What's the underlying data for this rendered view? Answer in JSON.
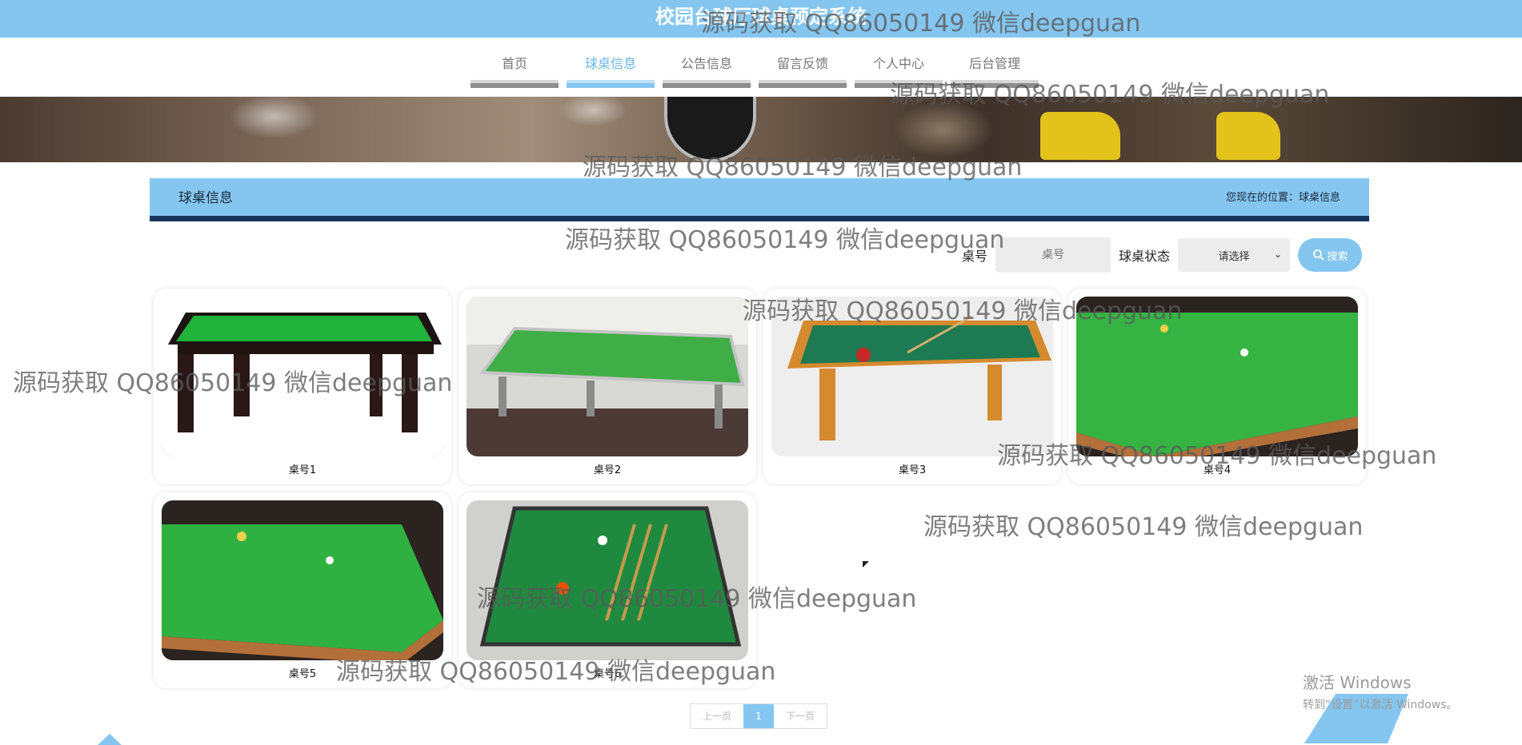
{
  "site_title": "校园台球厅球桌预定系统",
  "nav": [
    {
      "label": "首页",
      "active": false
    },
    {
      "label": "球桌信息",
      "active": true
    },
    {
      "label": "公告信息",
      "active": false
    },
    {
      "label": "留言反馈",
      "active": false
    },
    {
      "label": "个人中心",
      "active": false
    },
    {
      "label": "后台管理",
      "active": false
    }
  ],
  "section": {
    "title": "球桌信息",
    "breadcrumb": "您现在的位置：球桌信息"
  },
  "search": {
    "table_label": "桌号",
    "table_placeholder": "桌号",
    "status_label": "球桌状态",
    "status_selected": "请选择",
    "button_label": "搜索"
  },
  "tables": [
    {
      "name": "桌号1"
    },
    {
      "name": "桌号2"
    },
    {
      "name": "桌号3"
    },
    {
      "name": "桌号4"
    },
    {
      "name": "桌号5"
    },
    {
      "name": "桌号6"
    }
  ],
  "pagination": {
    "prev": "上一页",
    "current": "1",
    "next": "下一页"
  },
  "watermark": "源码获取 QQ86050149 微信deepguan",
  "windows_activation": {
    "line1": "激活 Windows",
    "line2": "转到“设置”以激活 Windows。"
  },
  "colors": {
    "accent": "#85c6f0",
    "header_border": "#17375e"
  }
}
